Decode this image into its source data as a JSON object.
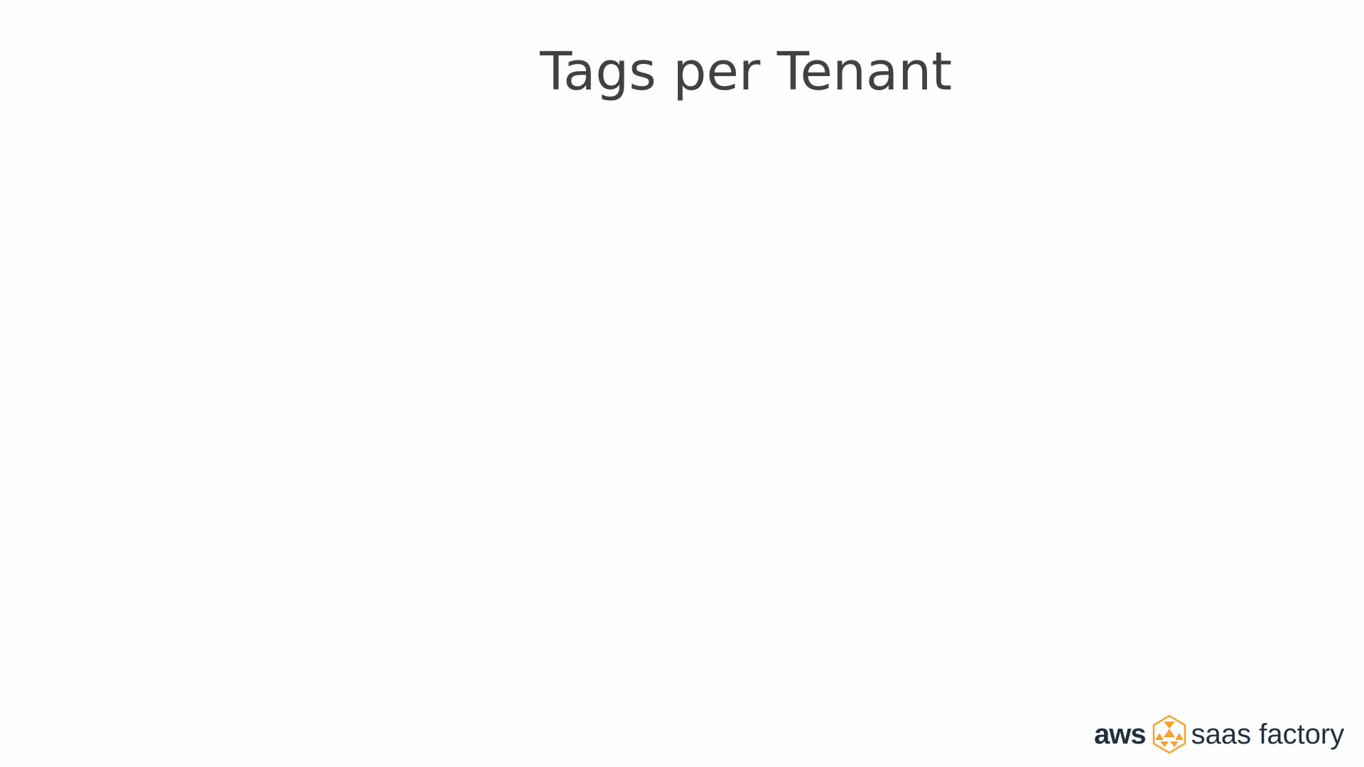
{
  "slide": {
    "title": "Tags per Tenant",
    "logo": {
      "brand": "aws",
      "product": "saas factory",
      "mark_icon": "saas-factory-hexagon-icon",
      "accent_color": "#f7a034",
      "text_color": "#232f3e"
    }
  }
}
